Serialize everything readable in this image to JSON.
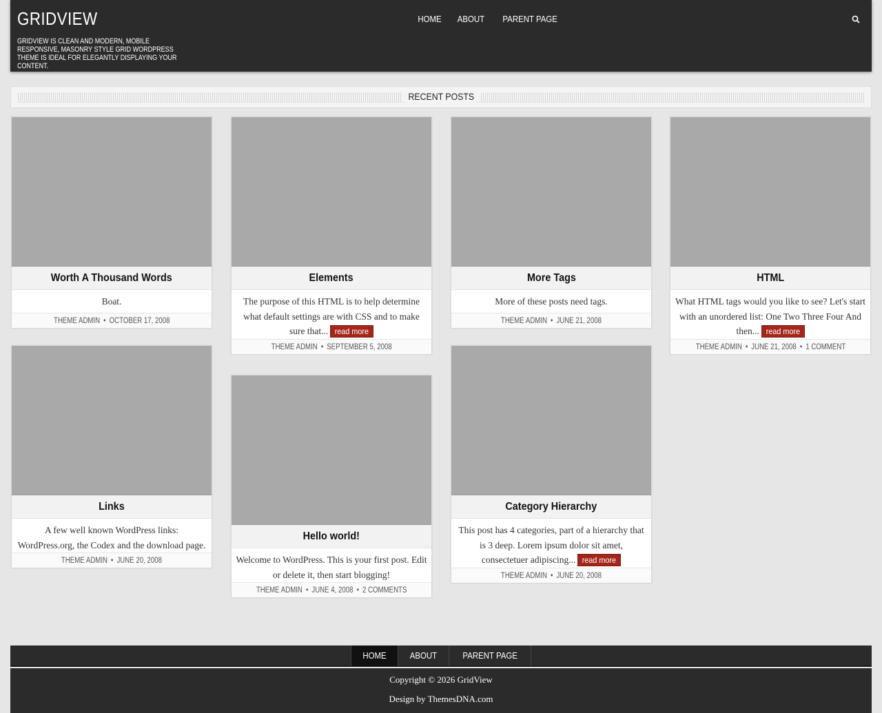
{
  "site": {
    "title": "GRIDVIEW",
    "description": "GRIDVIEW IS CLEAN AND MODERN, MOBILE RESPONSIVE, MASONRY STYLE GRID WORDPRESS THEME IS IDEAL FOR ELEGANTLY DISPLAYING YOUR CONTENT."
  },
  "nav": {
    "items": [
      "HOME",
      "ABOUT",
      "PARENT PAGE"
    ],
    "search_icon": "search-icon"
  },
  "section": {
    "title": "RECENT POSTS"
  },
  "read_more_label": "read more",
  "posts": [
    {
      "title": "Worth A Thousand Words",
      "excerpt": "Boat.",
      "author": "THEME ADMIN",
      "date": "OCTOBER 17, 2008",
      "comments": ""
    },
    {
      "title": "Elements",
      "excerpt": "The purpose of this HTML is to help determine what default settings are with CSS and to make sure that...",
      "author": "THEME ADMIN",
      "date": "SEPTEMBER 5, 2008",
      "comments": ""
    },
    {
      "title": "More Tags",
      "excerpt": "More of these posts need tags.",
      "author": "THEME ADMIN",
      "date": "JUNE 21, 2008",
      "comments": ""
    },
    {
      "title": "HTML",
      "excerpt": "What HTML tags would you like to see? Let's start with an unordered list: One Two Three Four And then...",
      "author": "THEME ADMIN",
      "date": "JUNE 21, 2008",
      "comments": "1 COMMENT"
    },
    {
      "title": "Links",
      "excerpt": "A few well known WordPress links: WordPress.org, the Codex and the download page.",
      "author": "THEME ADMIN",
      "date": "JUNE 20, 2008",
      "comments": ""
    },
    {
      "title": "Hello world!",
      "excerpt": "Welcome to WordPress. This is your first post. Edit or delete it, then start blogging!",
      "author": "THEME ADMIN",
      "date": "JUNE 4, 2008",
      "comments": "2 COMMENTS"
    },
    {
      "title": "Category Hierarchy",
      "excerpt": "This post has 4 categories, part of a hierarchy that is 3 deep. Lorem ipsum dolor sit amet, consectetuer adipiscing...",
      "author": "THEME ADMIN",
      "date": "JUNE 20, 2008",
      "comments": ""
    }
  ],
  "footer_nav": {
    "items": [
      "HOME",
      "ABOUT",
      "PARENT PAGE"
    ],
    "active": "HOME"
  },
  "footer": {
    "copyright": "Copyright © 2026 GridView",
    "design": "Design by ThemesDNA.com"
  },
  "colors": {
    "header_bg": "#2b2b2b",
    "page_bg": "#e6e6e6",
    "read_more_bg": "#a4261b",
    "thumb_placeholder": "#a9a9a9"
  }
}
